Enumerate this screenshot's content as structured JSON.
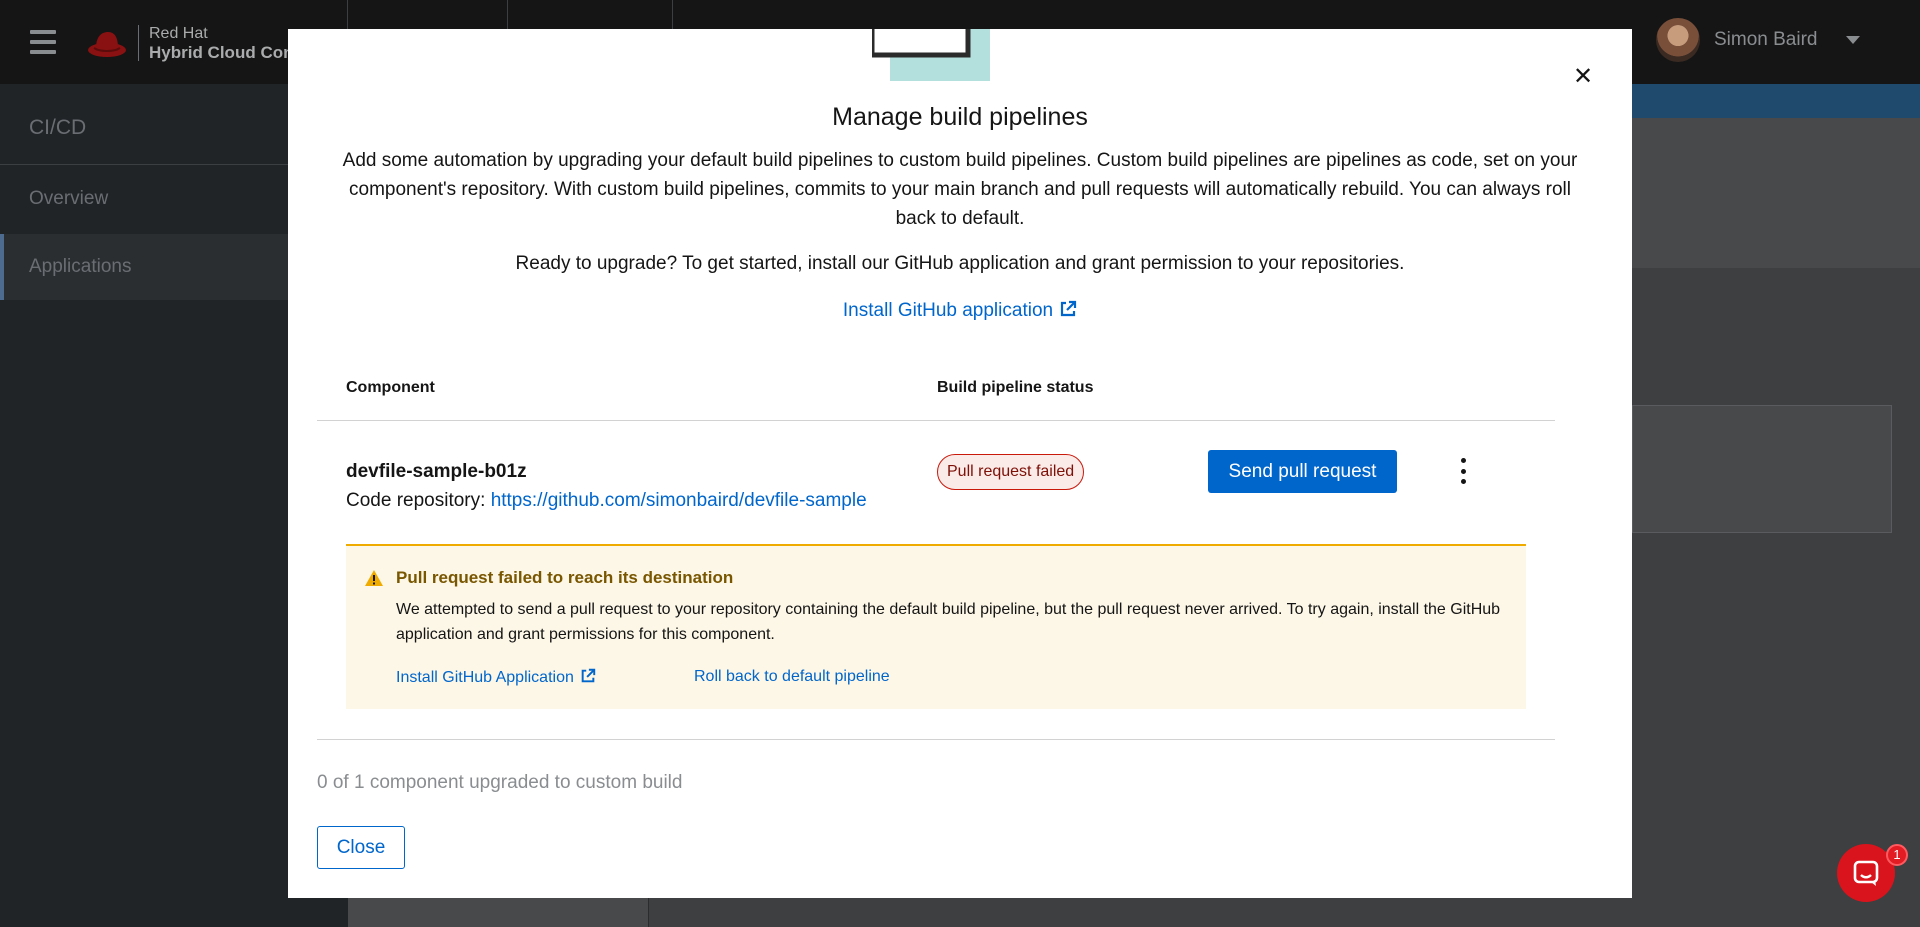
{
  "masthead": {
    "logo_line1": "Red Hat",
    "logo_line2": "Hybrid Cloud Cons",
    "user_name": "Simon Baird"
  },
  "sidebar": {
    "title": "CI/CD",
    "items": [
      {
        "label": "Overview",
        "active": false
      },
      {
        "label": "Applications",
        "active": true
      }
    ]
  },
  "modal": {
    "title": "Manage build pipelines",
    "description": "Add some automation by upgrading your default build pipelines to custom build pipelines. Custom build pipelines are pipelines as code, set on your component's repository. With custom build pipelines, commits to your main branch and pull requests will automatically rebuild. You can always roll back to default.",
    "ready_text": "Ready to upgrade? To get started, install our GitHub application and grant permission to your repositories.",
    "install_link": "Install GitHub application",
    "table": {
      "headers": {
        "component": "Component",
        "status": "Build pipeline status"
      },
      "rows": [
        {
          "name": "devfile-sample-b01z",
          "repo_label": "Code repository:",
          "repo_url": "https://github.com/simonbaird/devfile-sample",
          "status": "Pull request failed",
          "action": "Send pull request"
        }
      ]
    },
    "alert": {
      "title": "Pull request failed to reach its destination",
      "body": "We attempted to send a pull request to your repository containing the default build pipeline, but the pull request never arrived. To try again, install the GitHub application and grant permissions for this component.",
      "link_install": "Install GitHub Application",
      "link_rollback": "Roll back to default pipeline"
    },
    "summary": "0 of 1 component upgraded to custom build",
    "close_label": "Close"
  },
  "chat": {
    "badge_count": "1"
  },
  "colors": {
    "link": "#0066cc",
    "danger": "#c9190b",
    "warning": "#f0ab00",
    "chat": "#d9141c"
  }
}
